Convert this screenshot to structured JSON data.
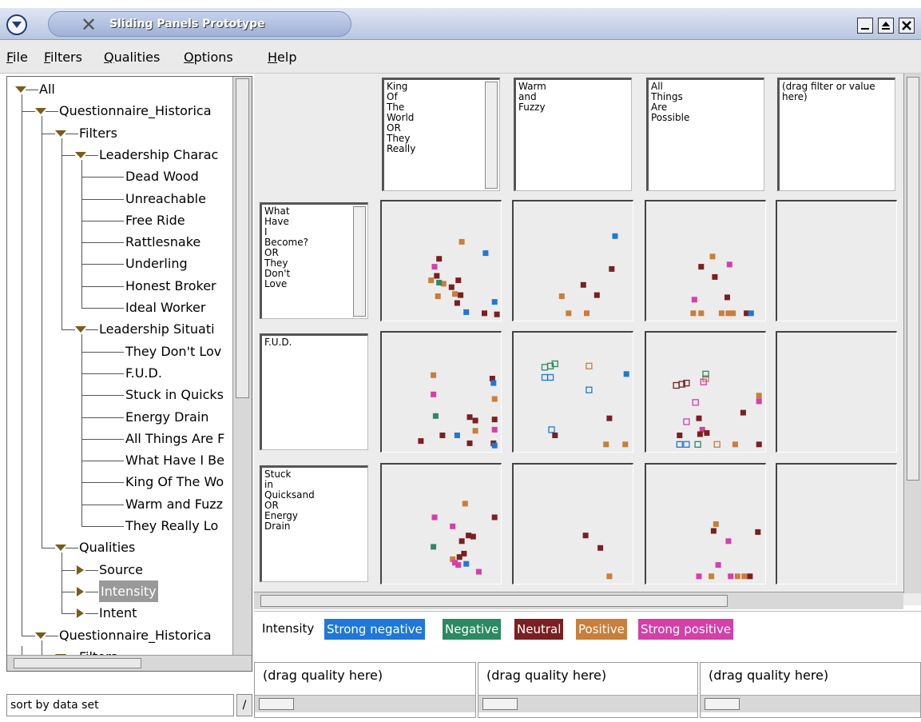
{
  "window": {
    "title": "Sliding Panels Prototype"
  },
  "menu": {
    "items": [
      "File",
      "Filters",
      "Qualities",
      "Options",
      "Help"
    ]
  },
  "tree": {
    "nodes": [
      {
        "label": "All",
        "level": 0,
        "expander": "down"
      },
      {
        "label": "Questionnaire_Historica",
        "level": 1,
        "expander": "down"
      },
      {
        "label": "Filters",
        "level": 2,
        "expander": "down"
      },
      {
        "label": "Leadership Charac",
        "level": 3,
        "expander": "down"
      },
      {
        "label": "Dead Wood",
        "level": 4
      },
      {
        "label": "Unreachable",
        "level": 4
      },
      {
        "label": "Free Ride",
        "level": 4
      },
      {
        "label": "Rattlesnake",
        "level": 4
      },
      {
        "label": "Underling",
        "level": 4
      },
      {
        "label": "Honest Broker",
        "level": 4
      },
      {
        "label": "Ideal Worker",
        "level": 4
      },
      {
        "label": "Leadership Situati",
        "level": 3,
        "expander": "down"
      },
      {
        "label": "They Don't Lov",
        "level": 4
      },
      {
        "label": "F.U.D.",
        "level": 4
      },
      {
        "label": "Stuck in Quicks",
        "level": 4
      },
      {
        "label": "Energy Drain",
        "level": 4
      },
      {
        "label": "All Things Are F",
        "level": 4
      },
      {
        "label": "What Have I Be",
        "level": 4
      },
      {
        "label": "King Of The Wo",
        "level": 4
      },
      {
        "label": "Warm and Fuzz",
        "level": 4
      },
      {
        "label": "They Really Lo",
        "level": 4
      },
      {
        "label": "Qualities",
        "level": 2,
        "expander": "down"
      },
      {
        "label": "Source",
        "level": 3,
        "expander": "right"
      },
      {
        "label": "Intensity",
        "level": 3,
        "expander": "right",
        "selected": true
      },
      {
        "label": "Intent",
        "level": 3,
        "expander": "right"
      },
      {
        "label": "Questionnaire_Historica",
        "level": 1,
        "expander": "down"
      },
      {
        "label": "Filters",
        "level": 2,
        "expander": "down"
      }
    ],
    "sort_label": "sort by data set",
    "sort_arrow": "/"
  },
  "columns": [
    {
      "text": "King\nOf\nThe\nWorld\nOR\nThey\nReally",
      "scroll": true
    },
    {
      "text": "Warm\nand\nFuzzy",
      "scroll": false
    },
    {
      "text": "All\nThings\nAre\nPossible",
      "scroll": false
    },
    {
      "text": "(drag filter or value\nhere)",
      "scroll": false
    }
  ],
  "rows": [
    {
      "text": "What\nHave\nI\nBecome?\nOR\nThey\nDon't\nLove",
      "scroll": true
    },
    {
      "text": "F.U.D.",
      "scroll": false
    },
    {
      "text": "Stuck\nin\nQuicksand\nOR\nEnergy\nDrain",
      "scroll": false
    }
  ],
  "legend": {
    "title": "Intensity",
    "items": [
      {
        "label": "Strong negative",
        "color": "#1e78d8"
      },
      {
        "label": "Negative",
        "color": "#2a8a62"
      },
      {
        "label": "Neutral",
        "color": "#7a1f22"
      },
      {
        "label": "Positive",
        "color": "#c97e3a"
      },
      {
        "label": "Strong positive",
        "color": "#d43fa8"
      }
    ]
  },
  "quality_zones": [
    {
      "label": "(drag quality here)"
    },
    {
      "label": "(drag quality here)"
    },
    {
      "label": "(drag quality here)"
    }
  ],
  "chart_data": {
    "type": "scatter",
    "xlim": [
      0,
      1
    ],
    "ylim": [
      0,
      1
    ],
    "color_key": {
      "sn": "#1e78d8",
      "n": "#2a8a62",
      "u": "#7a1f22",
      "p": "#c97e3a",
      "sp": "#d43fa8"
    },
    "cells": [
      {
        "row": 0,
        "col": 0,
        "points": [
          {
            "x": 0.68,
            "y": 0.67,
            "c": "p"
          },
          {
            "x": 0.89,
            "y": 0.57,
            "c": "sn"
          },
          {
            "x": 0.48,
            "y": 0.52,
            "c": "u"
          },
          {
            "x": 0.44,
            "y": 0.45,
            "c": "sp"
          },
          {
            "x": 0.46,
            "y": 0.37,
            "c": "u"
          },
          {
            "x": 0.52,
            "y": 0.3,
            "c": "p"
          },
          {
            "x": 0.41,
            "y": 0.33,
            "c": "p"
          },
          {
            "x": 0.48,
            "y": 0.31,
            "c": "n"
          },
          {
            "x": 0.59,
            "y": 0.27,
            "c": "u"
          },
          {
            "x": 0.65,
            "y": 0.33,
            "c": "u"
          },
          {
            "x": 0.47,
            "y": 0.19,
            "c": "p"
          },
          {
            "x": 0.64,
            "y": 0.13,
            "c": "u"
          },
          {
            "x": 0.67,
            "y": 0.2,
            "c": "u"
          },
          {
            "x": 0.62,
            "y": 0.21,
            "c": "p"
          },
          {
            "x": 0.97,
            "y": 0.14,
            "c": "sn"
          },
          {
            "x": 0.72,
            "y": 0.05,
            "c": "sn"
          },
          {
            "x": 0.88,
            "y": 0.04,
            "c": "u"
          },
          {
            "x": 0.99,
            "y": 0.03,
            "c": "u"
          }
        ]
      },
      {
        "row": 0,
        "col": 1,
        "points": [
          {
            "x": 0.87,
            "y": 0.72,
            "c": "sn"
          },
          {
            "x": 0.84,
            "y": 0.43,
            "c": "u"
          },
          {
            "x": 0.59,
            "y": 0.29,
            "c": "u"
          },
          {
            "x": 0.71,
            "y": 0.2,
            "c": "u"
          },
          {
            "x": 0.4,
            "y": 0.19,
            "c": "p"
          },
          {
            "x": 0.46,
            "y": 0.04,
            "c": "p"
          },
          {
            "x": 0.62,
            "y": 0.04,
            "c": "p"
          }
        ]
      },
      {
        "row": 0,
        "col": 2,
        "points": [
          {
            "x": 0.56,
            "y": 0.54,
            "c": "p"
          },
          {
            "x": 0.46,
            "y": 0.45,
            "c": "u"
          },
          {
            "x": 0.71,
            "y": 0.47,
            "c": "sp"
          },
          {
            "x": 0.58,
            "y": 0.36,
            "c": "u"
          },
          {
            "x": 0.69,
            "y": 0.18,
            "c": "u"
          },
          {
            "x": 0.4,
            "y": 0.16,
            "c": "sp"
          },
          {
            "x": 0.39,
            "y": 0.04,
            "c": "p"
          },
          {
            "x": 0.46,
            "y": 0.04,
            "c": "p"
          },
          {
            "x": 0.64,
            "y": 0.04,
            "c": "p"
          },
          {
            "x": 0.7,
            "y": 0.04,
            "c": "p"
          },
          {
            "x": 0.74,
            "y": 0.04,
            "c": "p"
          },
          {
            "x": 0.86,
            "y": 0.04,
            "c": "u"
          },
          {
            "x": 0.9,
            "y": 0.04,
            "c": "sn"
          }
        ]
      },
      {
        "row": 1,
        "col": 0,
        "points": [
          {
            "x": 0.43,
            "y": 0.65,
            "c": "p"
          },
          {
            "x": 0.43,
            "y": 0.48,
            "c": "sp"
          },
          {
            "x": 0.95,
            "y": 0.62,
            "c": "u"
          },
          {
            "x": 0.96,
            "y": 0.58,
            "c": "sn"
          },
          {
            "x": 0.97,
            "y": 0.44,
            "c": "p"
          },
          {
            "x": 0.45,
            "y": 0.29,
            "c": "n"
          },
          {
            "x": 0.75,
            "y": 0.28,
            "c": "u"
          },
          {
            "x": 0.8,
            "y": 0.25,
            "c": "u"
          },
          {
            "x": 0.8,
            "y": 0.16,
            "c": "p"
          },
          {
            "x": 0.97,
            "y": 0.26,
            "c": "u"
          },
          {
            "x": 0.97,
            "y": 0.17,
            "c": "sp"
          },
          {
            "x": 0.64,
            "y": 0.12,
            "c": "sn"
          },
          {
            "x": 0.51,
            "y": 0.12,
            "c": "u"
          },
          {
            "x": 0.32,
            "y": 0.07,
            "c": "u"
          },
          {
            "x": 0.75,
            "y": 0.05,
            "c": "u"
          },
          {
            "x": 0.96,
            "y": 0.05,
            "c": "u"
          },
          {
            "x": 0.97,
            "y": 0.03,
            "c": "sn"
          }
        ]
      },
      {
        "row": 1,
        "col": 1,
        "points": [
          {
            "x": 0.25,
            "y": 0.72,
            "c": "n",
            "o": true
          },
          {
            "x": 0.3,
            "y": 0.73,
            "c": "n",
            "o": true
          },
          {
            "x": 0.34,
            "y": 0.75,
            "c": "n",
            "o": true
          },
          {
            "x": 0.25,
            "y": 0.63,
            "c": "sn",
            "o": true
          },
          {
            "x": 0.3,
            "y": 0.63,
            "c": "sn",
            "o": true
          },
          {
            "x": 0.64,
            "y": 0.73,
            "c": "p",
            "o": true
          },
          {
            "x": 0.97,
            "y": 0.66,
            "c": "sn"
          },
          {
            "x": 0.64,
            "y": 0.52,
            "c": "sn",
            "o": true
          },
          {
            "x": 0.82,
            "y": 0.27,
            "c": "u"
          },
          {
            "x": 0.31,
            "y": 0.17,
            "c": "sn",
            "o": true
          },
          {
            "x": 0.34,
            "y": 0.12,
            "c": "u"
          },
          {
            "x": 0.79,
            "y": 0.04,
            "c": "p"
          },
          {
            "x": 0.96,
            "y": 0.04,
            "c": "p"
          }
        ]
      },
      {
        "row": 1,
        "col": 2,
        "points": [
          {
            "x": 0.5,
            "y": 0.62,
            "c": "p",
            "o": true
          },
          {
            "x": 0.48,
            "y": 0.59,
            "c": "sp",
            "o": true
          },
          {
            "x": 0.5,
            "y": 0.66,
            "c": "n",
            "o": true
          },
          {
            "x": 0.24,
            "y": 0.56,
            "c": "u",
            "o": true
          },
          {
            "x": 0.29,
            "y": 0.57,
            "c": "u",
            "o": true
          },
          {
            "x": 0.33,
            "y": 0.58,
            "c": "u",
            "o": true
          },
          {
            "x": 0.97,
            "y": 0.47,
            "c": "p"
          },
          {
            "x": 0.97,
            "y": 0.42,
            "c": "sp"
          },
          {
            "x": 0.41,
            "y": 0.41,
            "c": "sp",
            "o": true
          },
          {
            "x": 0.83,
            "y": 0.32,
            "c": "u"
          },
          {
            "x": 0.33,
            "y": 0.24,
            "c": "sp",
            "o": true
          },
          {
            "x": 0.44,
            "y": 0.27,
            "c": "u"
          },
          {
            "x": 0.47,
            "y": 0.17,
            "c": "sp"
          },
          {
            "x": 0.51,
            "y": 0.14,
            "c": "u"
          },
          {
            "x": 0.45,
            "y": 0.13,
            "c": "u"
          },
          {
            "x": 0.27,
            "y": 0.12,
            "c": "u"
          },
          {
            "x": 0.27,
            "y": 0.04,
            "c": "sn",
            "o": true
          },
          {
            "x": 0.33,
            "y": 0.04,
            "c": "sn",
            "o": true
          },
          {
            "x": 0.43,
            "y": 0.04,
            "c": "n",
            "o": true
          },
          {
            "x": 0.6,
            "y": 0.04,
            "c": "p",
            "o": true
          },
          {
            "x": 0.76,
            "y": 0.04,
            "c": "p"
          },
          {
            "x": 0.97,
            "y": 0.04,
            "c": "u"
          }
        ]
      },
      {
        "row": 2,
        "col": 0,
        "points": [
          {
            "x": 0.71,
            "y": 0.68,
            "c": "p"
          },
          {
            "x": 0.44,
            "y": 0.56,
            "c": "sp"
          },
          {
            "x": 0.97,
            "y": 0.56,
            "c": "u"
          },
          {
            "x": 0.6,
            "y": 0.48,
            "c": "sp"
          },
          {
            "x": 0.74,
            "y": 0.4,
            "c": "u"
          },
          {
            "x": 0.78,
            "y": 0.39,
            "c": "u"
          },
          {
            "x": 0.68,
            "y": 0.35,
            "c": "u"
          },
          {
            "x": 0.43,
            "y": 0.3,
            "c": "n"
          },
          {
            "x": 0.7,
            "y": 0.24,
            "c": "u"
          },
          {
            "x": 0.66,
            "y": 0.21,
            "c": "u"
          },
          {
            "x": 0.6,
            "y": 0.19,
            "c": "p"
          },
          {
            "x": 0.65,
            "y": 0.14,
            "c": "sp"
          },
          {
            "x": 0.72,
            "y": 0.15,
            "c": "sn"
          },
          {
            "x": 0.83,
            "y": 0.08,
            "c": "sp"
          },
          {
            "x": 0.62,
            "y": 0.16,
            "c": "sp"
          }
        ]
      },
      {
        "row": 2,
        "col": 1,
        "points": [
          {
            "x": 0.61,
            "y": 0.4,
            "c": "u"
          },
          {
            "x": 0.74,
            "y": 0.29,
            "c": "u"
          },
          {
            "x": 0.82,
            "y": 0.04,
            "c": "p"
          }
        ]
      },
      {
        "row": 2,
        "col": 2,
        "points": [
          {
            "x": 0.59,
            "y": 0.5,
            "c": "p"
          },
          {
            "x": 0.57,
            "y": 0.44,
            "c": "u"
          },
          {
            "x": 0.96,
            "y": 0.43,
            "c": "u"
          },
          {
            "x": 0.7,
            "y": 0.35,
            "c": "sp"
          },
          {
            "x": 0.61,
            "y": 0.14,
            "c": "sp"
          },
          {
            "x": 0.44,
            "y": 0.04,
            "c": "sp"
          },
          {
            "x": 0.55,
            "y": 0.04,
            "c": "p"
          },
          {
            "x": 0.72,
            "y": 0.04,
            "c": "sp"
          },
          {
            "x": 0.78,
            "y": 0.04,
            "c": "p"
          },
          {
            "x": 0.84,
            "y": 0.04,
            "c": "p"
          },
          {
            "x": 0.89,
            "y": 0.04,
            "c": "u"
          }
        ]
      }
    ]
  }
}
